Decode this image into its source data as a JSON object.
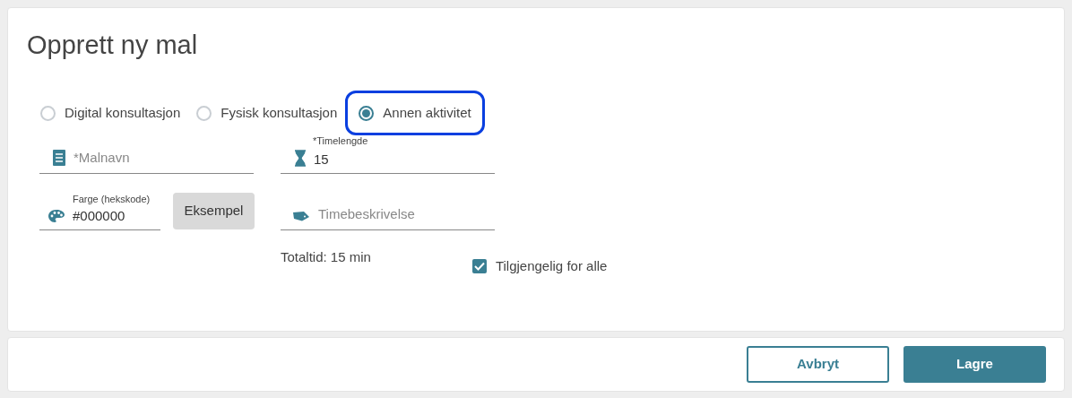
{
  "title": "Opprett ny mal",
  "appointment_types": [
    {
      "label": "Digital konsultasjon",
      "selected": false,
      "focused": false
    },
    {
      "label": "Fysisk konsultasjon",
      "selected": false,
      "focused": false
    },
    {
      "label": "Annen aktivitet",
      "selected": true,
      "focused": true
    }
  ],
  "template_name": {
    "placeholder": "*Malnavn"
  },
  "duration": {
    "label": "*Timelengde",
    "value": "15"
  },
  "color": {
    "label": "Farge (hekskode)",
    "value": "#000000"
  },
  "example_button": "Eksempel",
  "description": {
    "placeholder": "Timebeskrivelse"
  },
  "total_time": "Totaltid: 15 min",
  "available_for_all": {
    "label": "Tilgjengelig for alle",
    "checked": true
  },
  "buttons": {
    "cancel": "Avbryt",
    "save": "Lagre"
  }
}
